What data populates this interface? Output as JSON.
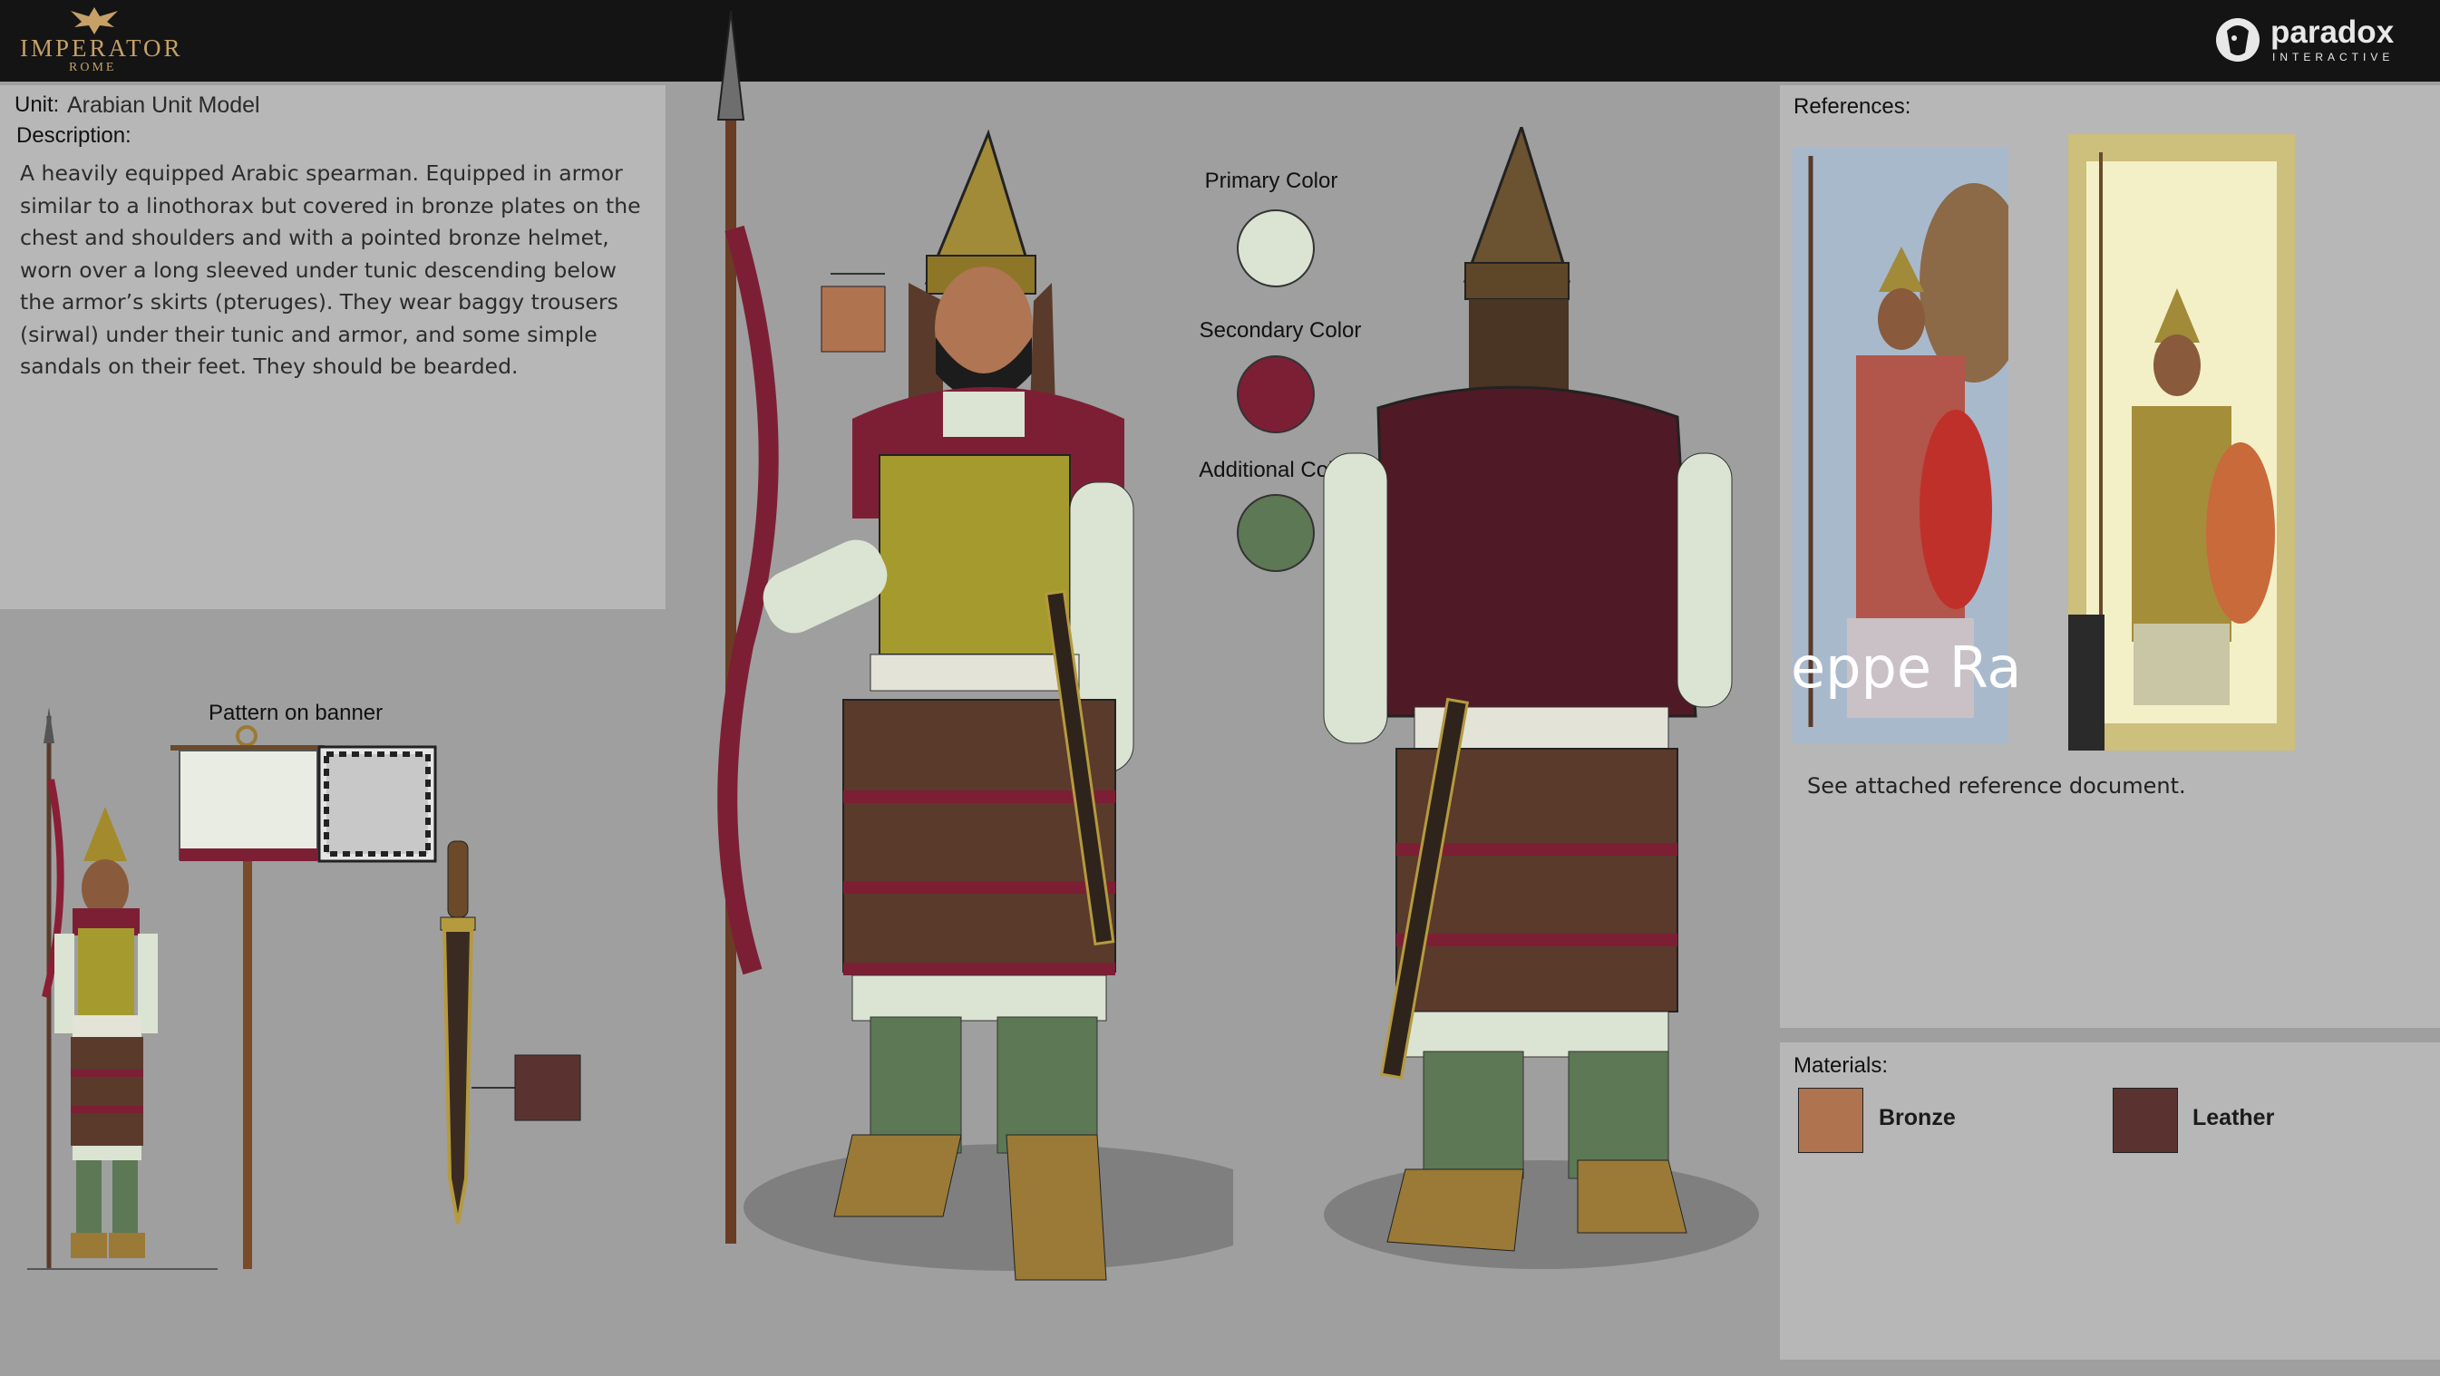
{
  "header": {
    "game_logo_title": "IMPERATOR",
    "game_logo_subtitle": "ROME",
    "publisher_logo": "paradox",
    "publisher_logo_sub": "INTERACTIVE"
  },
  "unit": {
    "unit_label": "Unit:",
    "unit_name": "Arabian Unit Model",
    "description_label": "Description:",
    "description": "A heavily equipped Arabic spearman. Equipped in armor similar to a linothorax but covered in bronze plates on the chest and shoulders and with a pointed bronze helmet, worn over a long sleeved under tunic descending below the armor’s skirts (pteruges). They wear baggy trousers (sirwal) under their tunic and armor, and some simple sandals on their feet. They should be bearded."
  },
  "colors": {
    "primary_label": "Primary Color",
    "primary_hex": "#dbe3d2",
    "secondary_label": "Secondary Color",
    "secondary_hex": "#7c1f35",
    "additional_label": "Additional Color",
    "additional_hex": "#5d7854"
  },
  "banner": {
    "label": "Pattern on banner"
  },
  "references": {
    "label": "References:",
    "image_overlay_text": "eppe Ra",
    "caption": "See attached reference document."
  },
  "materials": {
    "label": "Materials:",
    "items": [
      {
        "name": "Bronze",
        "hex": "#b0734f"
      },
      {
        "name": "Leather",
        "hex": "#5a3330"
      }
    ]
  }
}
